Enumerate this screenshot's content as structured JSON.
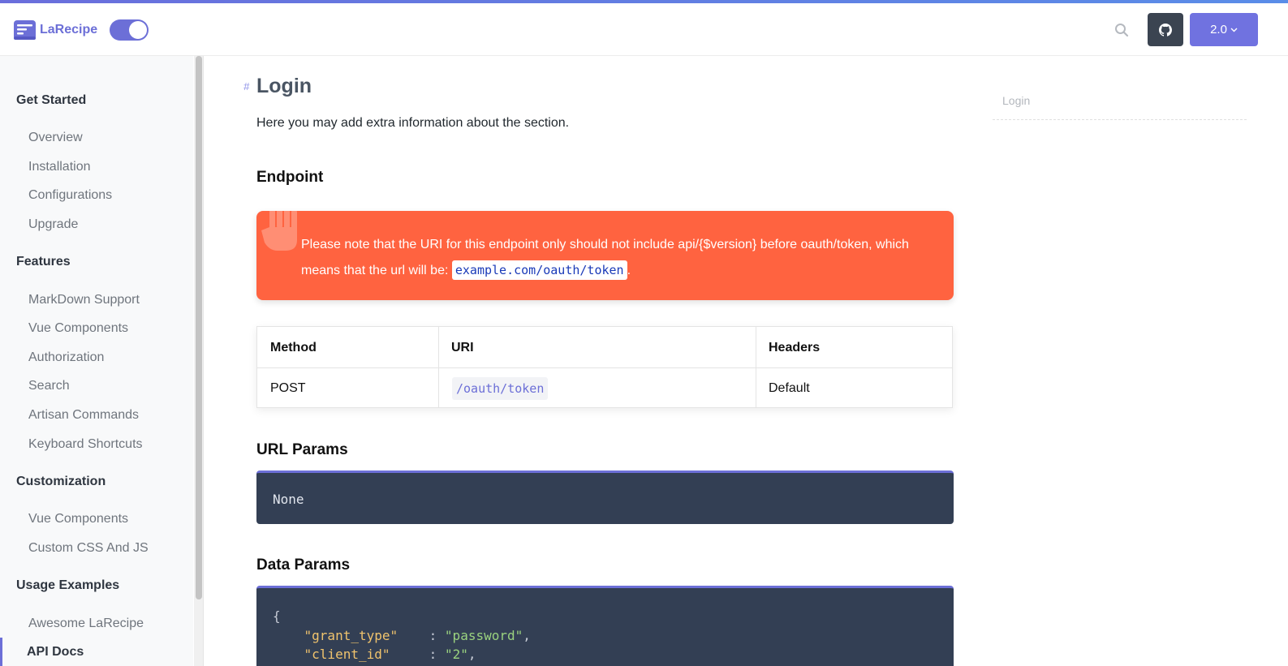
{
  "header": {
    "brand": "LaRecipe",
    "version_label": "2.0",
    "colors": {
      "accent": "#6c6fd7",
      "github_bg": "#3b4451"
    }
  },
  "sidebar": {
    "sections": [
      {
        "title": "Get Started",
        "items": [
          "Overview",
          "Installation",
          "Configurations",
          "Upgrade"
        ]
      },
      {
        "title": "Features",
        "items": [
          "MarkDown Support",
          "Vue Components",
          "Authorization",
          "Search",
          "Artisan Commands",
          "Keyboard Shortcuts"
        ]
      },
      {
        "title": "Customization",
        "items": [
          "Vue Components",
          "Custom CSS And JS"
        ]
      },
      {
        "title": "Usage Examples",
        "items": [
          "Awesome LaRecipe",
          "API Docs"
        ]
      }
    ],
    "active_item": "API Docs"
  },
  "main": {
    "title": "Login",
    "anchor": "#",
    "lead": "Here you may add extra information about the section.",
    "endpoint_heading": "Endpoint",
    "alert": {
      "text_before": "Please note that the URI for this endpoint only should not include api/{$version} before oauth/token, which means that the url will be: ",
      "code": "example.com/oauth/token",
      "text_after": ".",
      "color": "#ff6340"
    },
    "table": {
      "headers": [
        "Method",
        "URI",
        "Headers"
      ],
      "rows": [
        [
          "POST",
          "/oauth/token",
          "Default"
        ]
      ]
    },
    "url_params_heading": "URL Params",
    "url_params_value": "None",
    "data_params_heading": "Data Params",
    "data_params_code": {
      "open": "{",
      "lines": [
        {
          "key": "\"grant_type\"",
          "sep": "    : ",
          "value": "\"password\"",
          "end": ","
        },
        {
          "key": "\"client_id\"",
          "sep": "     : ",
          "value": "\"2\"",
          "end": ","
        }
      ]
    }
  },
  "toc": {
    "items": [
      "Login"
    ]
  }
}
